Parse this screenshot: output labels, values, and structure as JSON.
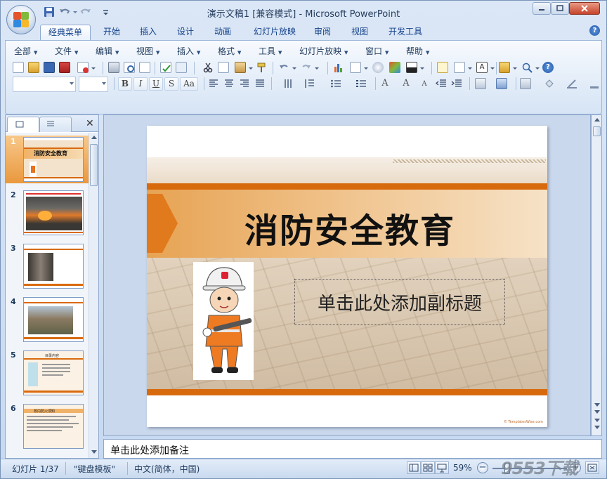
{
  "window": {
    "title": "演示文稿1 [兼容模式] - Microsoft PowerPoint"
  },
  "tabs": [
    {
      "label": "经典菜单",
      "active": true
    },
    {
      "label": "开始"
    },
    {
      "label": "插入"
    },
    {
      "label": "设计"
    },
    {
      "label": "动画"
    },
    {
      "label": "幻灯片放映"
    },
    {
      "label": "审阅"
    },
    {
      "label": "视图"
    },
    {
      "label": "开发工具"
    }
  ],
  "menubar": [
    {
      "label": "全部"
    },
    {
      "label": "文件"
    },
    {
      "label": "编辑"
    },
    {
      "label": "视图"
    },
    {
      "label": "插入"
    },
    {
      "label": "格式"
    },
    {
      "label": "工具"
    },
    {
      "label": "幻灯片放映"
    },
    {
      "label": "窗口"
    },
    {
      "label": "帮助"
    }
  ],
  "format": {
    "bold": "B",
    "italic": "I",
    "underline": "U",
    "shadow": "S",
    "case": "Aa"
  },
  "slides": [
    {
      "number": "1",
      "title": "消防安全教育"
    },
    {
      "number": "2"
    },
    {
      "number": "3"
    },
    {
      "number": "4"
    },
    {
      "number": "5",
      "title": "目录内容"
    },
    {
      "number": "6",
      "title": "校内防火须知"
    }
  ],
  "slide": {
    "title": "消防安全教育",
    "subtitle_placeholder": "单击此处添加副标题",
    "footer_credit": "© TemplatesWise.com"
  },
  "notes": {
    "placeholder": "单击此处添加备注"
  },
  "status": {
    "slide_indicator": "幻灯片 1/37",
    "theme": "\"键盘模板\"",
    "language": "中文(简体，中国)",
    "zoom": "59%"
  },
  "watermark": "9553下载",
  "colors": {
    "accent_orange": "#d86a0e",
    "ribbon_blue": "#dbe7f6",
    "selected_thumb": "#f0a650"
  }
}
